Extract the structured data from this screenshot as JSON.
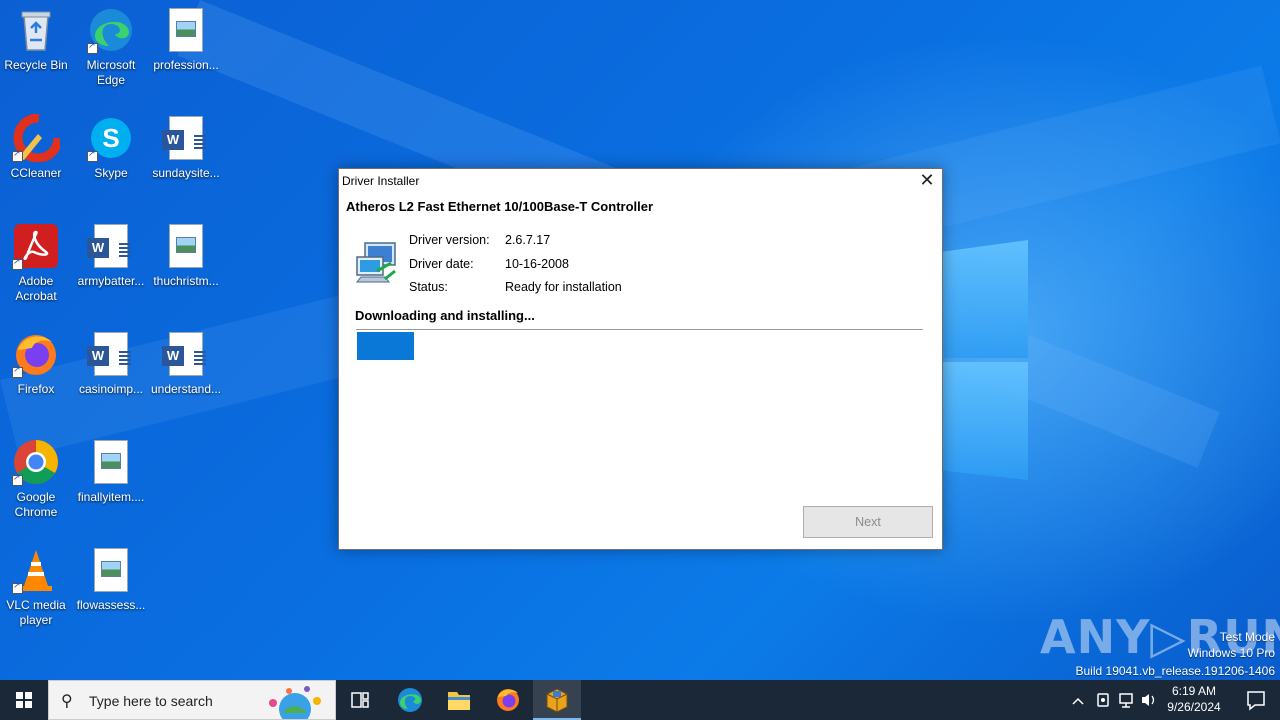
{
  "desktop": {
    "icons": [
      {
        "label": "Recycle Bin"
      },
      {
        "label": "Microsoft Edge"
      },
      {
        "label": "profession..."
      },
      {
        "label": "CCleaner"
      },
      {
        "label": "Skype"
      },
      {
        "label": "sundaysite..."
      },
      {
        "label": "Adobe Acrobat"
      },
      {
        "label": "armybatter..."
      },
      {
        "label": "thuchristm..."
      },
      {
        "label": "Firefox"
      },
      {
        "label": "casinoimp..."
      },
      {
        "label": "understand..."
      },
      {
        "label": "Google Chrome"
      },
      {
        "label": "finallyitem...."
      },
      {
        "label": "VLC media player"
      },
      {
        "label": "flowassess..."
      }
    ]
  },
  "dialog": {
    "title": "Driver Installer",
    "heading": "Atheros L2 Fast Ethernet 10/100Base-T Controller",
    "fields": [
      {
        "key": "Driver version:",
        "value": "2.6.7.17"
      },
      {
        "key": "Driver date:",
        "value": "10-16-2008"
      },
      {
        "key": "Status:",
        "value": "Ready for installation"
      }
    ],
    "progress_label": "Downloading and installing...",
    "progress_fraction": 0.1,
    "next_label": "Next",
    "close_glyph": "✕"
  },
  "watermark": {
    "brand": "ANY▷RUN",
    "line1": "Test Mode",
    "line2": "Windows 10 Pro",
    "line3": "Build 19041.vb_release.191206-1406"
  },
  "taskbar": {
    "search_placeholder": "Type here to search",
    "clock_time": "6:19 AM",
    "clock_date": "9/26/2024"
  },
  "colors": {
    "progress": "#0a78d7",
    "taskbar": "#1b2838",
    "desktop": "#0a6ee0"
  }
}
